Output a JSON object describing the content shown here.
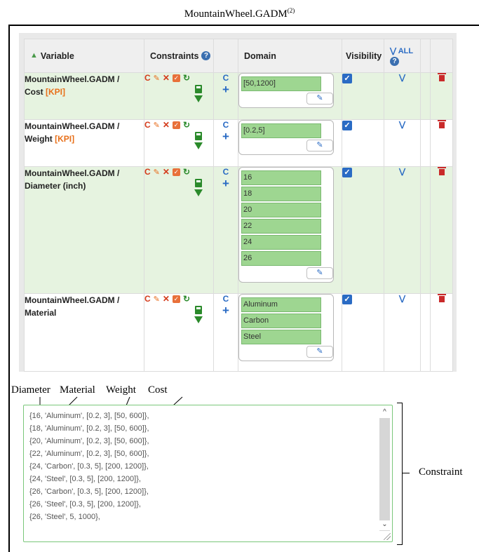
{
  "figure_title": "MountainWheel.GADM",
  "figure_title_sup": "(2)",
  "table": {
    "headers": {
      "variable": "Variable",
      "constraints": "Constraints",
      "domain": "Domain",
      "visibility": "Visibility",
      "all": "ALL"
    },
    "rows": [
      {
        "name": "MountainWheel.GADM /",
        "sub": "Cost",
        "kpi": "[KPI]",
        "domain": [
          "[50,1200]"
        ]
      },
      {
        "name": "MountainWheel.GADM /",
        "sub": "Weight",
        "kpi": "[KPI]",
        "domain": [
          "[0.2,5]"
        ]
      },
      {
        "name": "MountainWheel.GADM /",
        "sub": "Diameter (inch)",
        "kpi": "",
        "domain": [
          "16",
          "18",
          "20",
          "22",
          "24",
          "26"
        ]
      },
      {
        "name": "MountainWheel.GADM /",
        "sub": "Material",
        "kpi": "",
        "domain": [
          "Aluminum",
          "Carbon",
          "Steel"
        ]
      }
    ],
    "row_icons": {
      "c_label": "C",
      "c_blue_label": "C",
      "plus_label": "+"
    }
  },
  "annotation_labels": {
    "diameter": "Diameter",
    "material": "Material",
    "weight": "Weight",
    "cost": "Cost",
    "constraint": "Constraint"
  },
  "constraint_lines": [
    "{16, 'Aluminum', [0.2, 3], [50, 600]},",
    "{18, 'Aluminum', [0.2, 3], [50, 600]},",
    "{20, 'Aluminum', [0.2, 3], [50, 600]},",
    "{22, 'Aluminum', [0.2, 3], [50, 600]},",
    "{24, 'Carbon', [0.3, 5], [200, 1200]},",
    "{24, 'Steel', [0.3, 5], [200, 1200]},",
    "{26, 'Carbon', [0.3, 5], [200, 1200]},",
    "{26, 'Steel', [0.3, 5], [200, 1200]},",
    "{26, 'Steel', 5, 1000},"
  ],
  "colors": {
    "row_green": "#e6f3e0",
    "domain_green": "#9ed691",
    "kpi_orange": "#e8701a",
    "link_blue": "#2a6bc4",
    "delete_red": "#c92a2a"
  }
}
